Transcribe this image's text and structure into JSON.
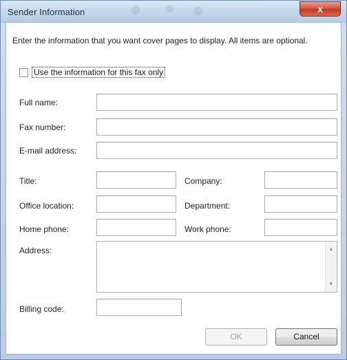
{
  "window": {
    "title": "Sender Information",
    "close_glyph": "x"
  },
  "description": "Enter the information that you want cover pages to display. All items are optional.",
  "checkbox": {
    "label": "Use the information for this fax only",
    "checked": false
  },
  "labels": {
    "full_name": "Full name:",
    "fax_number": "Fax number:",
    "email": "E-mail address:",
    "title": "Title:",
    "company": "Company:",
    "office_location": "Office location:",
    "department": "Department:",
    "home_phone": "Home phone:",
    "work_phone": "Work phone:",
    "address": "Address:",
    "billing_code": "Billing code:"
  },
  "values": {
    "full_name": "",
    "fax_number": "",
    "email": "",
    "title": "",
    "company": "",
    "office_location": "",
    "department": "",
    "home_phone": "",
    "work_phone": "",
    "address": "",
    "billing_code": ""
  },
  "buttons": {
    "ok": "OK",
    "cancel": "Cancel"
  },
  "icons": {
    "close": "close-icon",
    "scroll_up": "scroll-up-arrow-icon",
    "scroll_down": "scroll-down-arrow-icon"
  },
  "colors": {
    "title_bar": "#c7d9ee",
    "close_button": "#d6533f"
  }
}
